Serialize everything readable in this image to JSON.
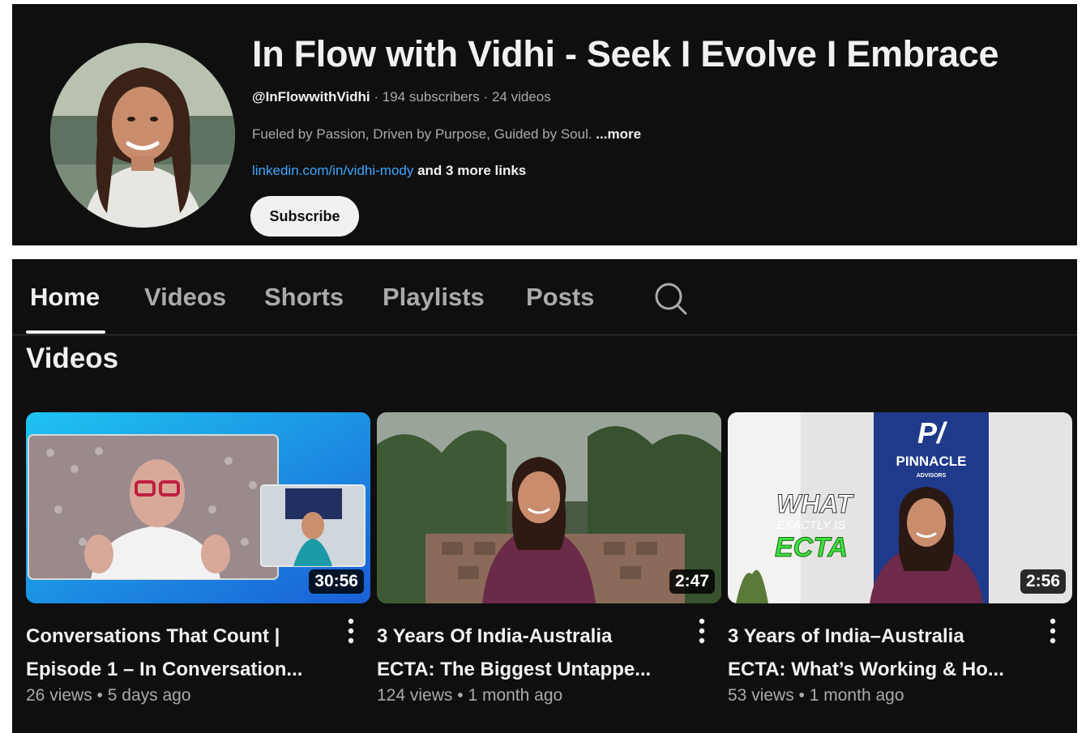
{
  "channel": {
    "title": "In Flow with Vidhi - Seek I Evolve I Embrace",
    "handle": "@InFlowwithVidhi",
    "separator": "·",
    "subscribers": "194 subscribers",
    "videos_count": "24 videos",
    "description": "Fueled by Passion, Driven by Purpose, Guided by Soul. ",
    "more_label": "...more",
    "link_text": "linkedin.com/in/vidhi-mody",
    "more_links": " and 3 more links",
    "subscribe_label": "Subscribe"
  },
  "tabs": [
    {
      "label": "Home",
      "active": true
    },
    {
      "label": "Videos"
    },
    {
      "label": "Shorts"
    },
    {
      "label": "Playlists"
    },
    {
      "label": "Posts"
    }
  ],
  "search_icon": "search-icon",
  "section_title": "Videos",
  "videos": [
    {
      "title_line1": "Conversations That Count |",
      "title_line2": "Episode 1 – In Conversation...",
      "duration": "30:56",
      "views": "26 views",
      "dot": "•",
      "age": "5 days ago"
    },
    {
      "title_line1": "3 Years Of India-Australia",
      "title_line2": "ECTA: The Biggest Untappe...",
      "duration": "2:47",
      "views": "124 views",
      "dot": "•",
      "age": "1 month ago"
    },
    {
      "title_line1": "3 Years of India–Australia",
      "title_line2": "ECTA: What’s Working & Ho...",
      "duration": "2:56",
      "views": "53 views",
      "dot": "•",
      "age": "1 month ago",
      "thumb_text": {
        "brand": "PINNACLE",
        "brand_sub": "ADVISORS",
        "what": "WHAT",
        "exactly_is": "EXACTLY IS",
        "ecta": "ECTA"
      }
    }
  ],
  "colors": {
    "background": "#0f0f0f",
    "text_primary": "#f1f1f1",
    "text_secondary": "#aaaaaa",
    "link": "#3ea6ff",
    "ecta_green": "#3ee03e"
  }
}
